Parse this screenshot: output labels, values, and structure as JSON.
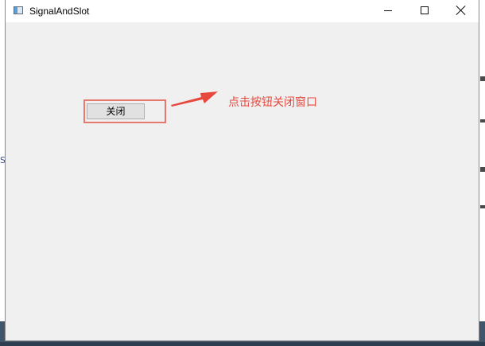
{
  "window": {
    "title": "SignalAndSlot",
    "app_icon": "window-app-icon"
  },
  "caption_buttons": {
    "minimize_icon": "minimize-icon",
    "maximize_icon": "maximize-icon",
    "close_icon": "close-icon"
  },
  "main": {
    "close_button_label": "关闭",
    "annotation_text": "点击按钮关闭窗口",
    "arrow_icon": "arrow-right-icon"
  },
  "colors": {
    "annotation": "#e8473c",
    "highlight_border": "#e8786e",
    "client_background": "#f0f0f0",
    "button_face": "#e1e1e1"
  }
}
